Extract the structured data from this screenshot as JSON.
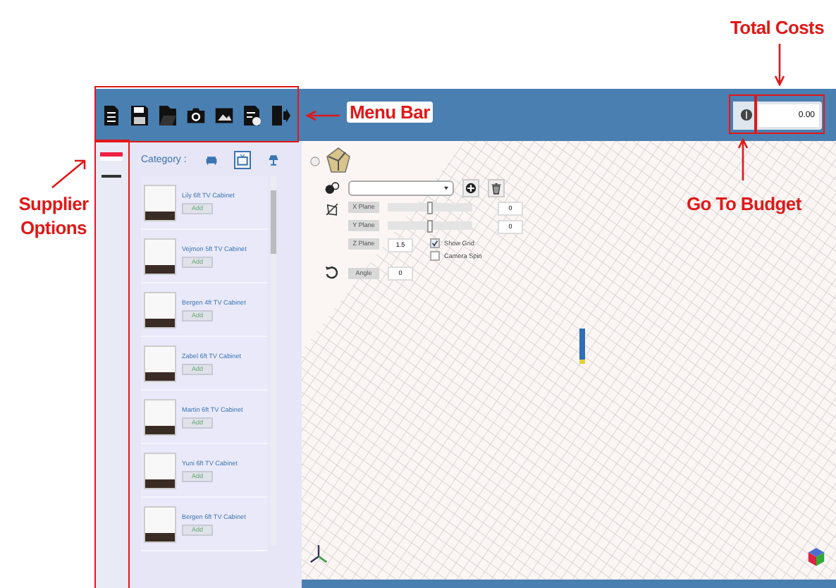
{
  "menu_bar": {
    "budget_value": "0.00"
  },
  "category_label": "Category :",
  "categories": [
    {
      "kind": "sofa",
      "selected": false
    },
    {
      "kind": "tv",
      "selected": true
    },
    {
      "kind": "lamp",
      "selected": false
    }
  ],
  "products": [
    {
      "name": "Lily 6ft TV Cabinet",
      "button": "Add"
    },
    {
      "name": "Vejmon 5ft TV Cabinet",
      "button": "Add"
    },
    {
      "name": "Bergen 4ft TV Cabinet",
      "button": "Add"
    },
    {
      "name": "Zabel 6ft TV Cabinet",
      "button": "Add"
    },
    {
      "name": "Martin 6ft TV Cabinet",
      "button": "Add"
    },
    {
      "name": "Yuni 6ft TV Cabinet",
      "button": "Add"
    },
    {
      "name": "Bergen 6ft TV Cabinet",
      "button": "Add"
    }
  ],
  "planes": [
    {
      "label": "X Plane",
      "kind": "slider",
      "level": 0.5,
      "value": "0"
    },
    {
      "label": "Y Plane",
      "kind": "slider",
      "level": 0.5,
      "value": "0"
    },
    {
      "label": "Z Plane",
      "kind": "input",
      "value": "1.5"
    }
  ],
  "options": [
    {
      "label": "Show Grid",
      "checked": true
    },
    {
      "label": "Camera Spin",
      "checked": false
    }
  ],
  "angle": {
    "label": "Angle",
    "value": "0"
  },
  "annotations": [
    {
      "text": "Total Costs"
    },
    {
      "text": "Menu Bar"
    },
    {
      "text": "Supplier Options"
    },
    {
      "text": "Go To Budget"
    }
  ]
}
